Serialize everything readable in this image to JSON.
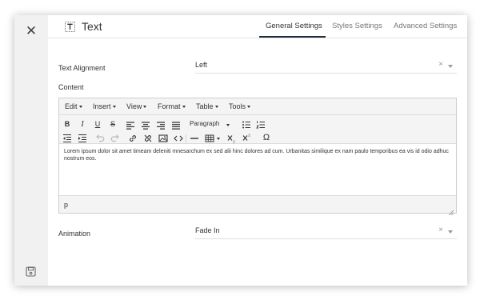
{
  "header": {
    "title": "Text",
    "tabs": [
      {
        "label": "General Settings",
        "active": true
      },
      {
        "label": "Styles Settings",
        "active": false
      },
      {
        "label": "Advanced Settings",
        "active": false
      }
    ]
  },
  "sidebar": {
    "close_icon": "close-icon",
    "save_icon": "save-icon"
  },
  "fields": {
    "text_alignment": {
      "label": "Text Alignment",
      "value": "Left",
      "clear": "×"
    },
    "content": {
      "label": "Content"
    },
    "animation": {
      "label": "Animation",
      "value": "Fade In",
      "clear": "×"
    }
  },
  "editor": {
    "menus": [
      "Edit",
      "Insert",
      "View",
      "Format",
      "Table",
      "Tools"
    ],
    "block_format": "Paragraph",
    "body_text": "Lorem ipsum dolor sit amet timeam deleniti mnesarchum ex sed alii hinc dolores ad cum. Urbanitas similique ex nam paulo temporibus ea vis id odio adhuc nostrum eos.",
    "status_path": "p",
    "toolbar_labels": {
      "bold": "B",
      "italic": "I",
      "underline": "U",
      "strike": "S",
      "omega": "Ω"
    }
  },
  "colors": {
    "accent": "#1f2d3d",
    "rail": "#f1f1f1",
    "toolbar": "#f4f4f4"
  }
}
